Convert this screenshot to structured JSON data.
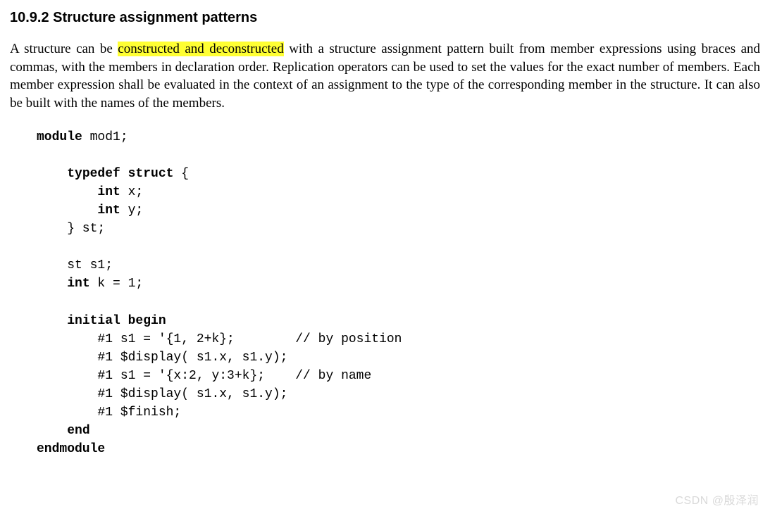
{
  "heading": "10.9.2 Structure assignment patterns",
  "para": {
    "p1": "A structure can be ",
    "hl": "constructed and deconstructed",
    "p2": " with a structure assignment pattern built from member expressions using braces and commas, with the members in declaration order. Replication operators can be used to set the values for the exact number of members. Each member expression shall be evaluated in the context of an assignment to the type of the corresponding member in the structure. It can also be built with the names of the members."
  },
  "code": {
    "l01a": "module",
    "l01b": " mod1;",
    "l02": "",
    "l03a": "    ",
    "l03b": "typedef struct",
    "l03c": " {",
    "l04a": "        ",
    "l04b": "int",
    "l04c": " x;",
    "l05a": "        ",
    "l05b": "int",
    "l05c": " y;",
    "l06": "    } st;",
    "l07": "",
    "l08": "    st s1;",
    "l09a": "    ",
    "l09b": "int",
    "l09c": " k = 1;",
    "l10": "",
    "l11a": "    ",
    "l11b": "initial begin",
    "l12": "        #1 s1 = '{1, 2+k};        // by position",
    "l13": "        #1 $display( s1.x, s1.y);",
    "l14": "        #1 s1 = '{x:2, y:3+k};    // by name",
    "l15": "        #1 $display( s1.x, s1.y);",
    "l16": "        #1 $finish;",
    "l17a": "    ",
    "l17b": "end",
    "l18": "endmodule"
  },
  "watermark": "CSDN @殷泽润"
}
